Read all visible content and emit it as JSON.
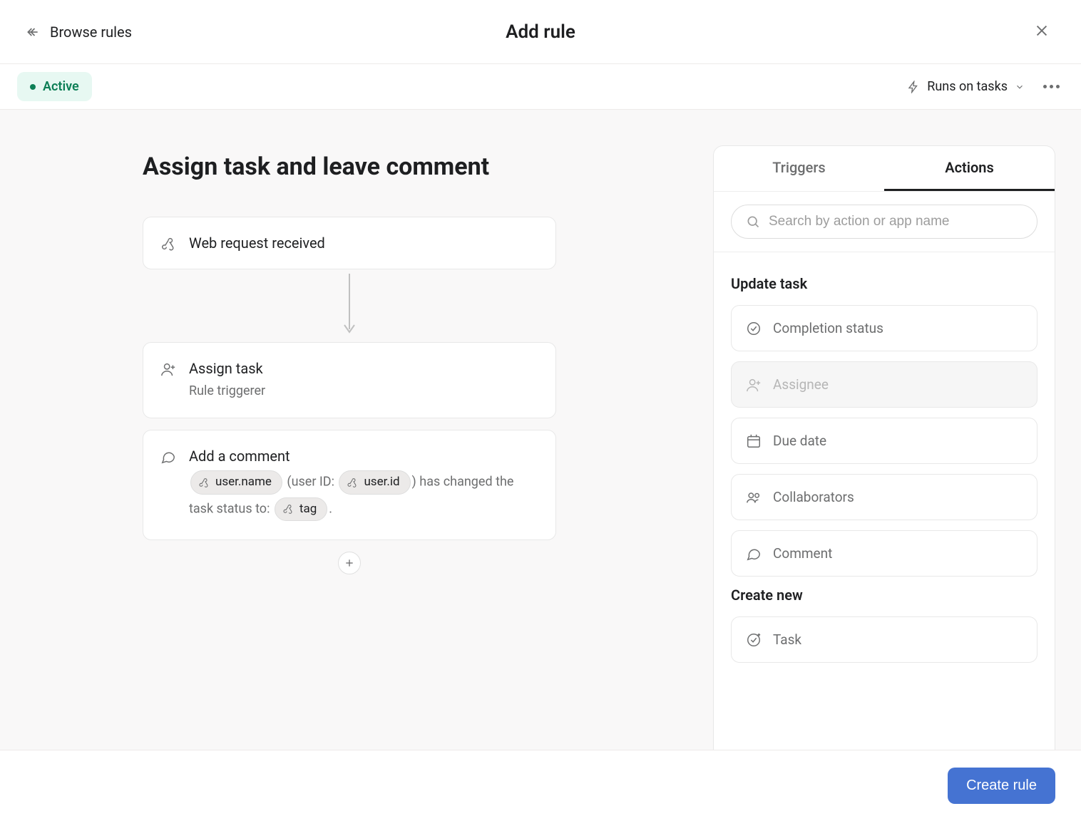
{
  "topbar": {
    "browse_label": "Browse rules",
    "title": "Add rule"
  },
  "subbar": {
    "status_label": "Active",
    "runs_on_label": "Runs on tasks"
  },
  "rule": {
    "title": "Assign task and leave comment",
    "trigger": {
      "label": "Web request received"
    },
    "actions": [
      {
        "title": "Assign task",
        "subtitle": "Rule triggerer"
      },
      {
        "title": "Add a comment",
        "comment_parts": {
          "token1": "user.name",
          "text1": " (user ID: ",
          "token2": "user.id",
          "text2": ") has changed the task status to: ",
          "token3": "tag",
          "text3": "."
        }
      }
    ]
  },
  "sidepanel": {
    "tabs": {
      "triggers": "Triggers",
      "actions": "Actions"
    },
    "search_placeholder": "Search by action or app name",
    "sections": [
      {
        "label": "Update task",
        "items": [
          {
            "key": "completion-status",
            "label": "Completion status",
            "disabled": false
          },
          {
            "key": "assignee",
            "label": "Assignee",
            "disabled": true
          },
          {
            "key": "due-date",
            "label": "Due date",
            "disabled": false
          },
          {
            "key": "collaborators",
            "label": "Collaborators",
            "disabled": false
          },
          {
            "key": "comment",
            "label": "Comment",
            "disabled": false
          }
        ]
      },
      {
        "label": "Create new",
        "items": [
          {
            "key": "task",
            "label": "Task",
            "disabled": false
          }
        ]
      }
    ]
  },
  "footer": {
    "create_label": "Create rule"
  }
}
